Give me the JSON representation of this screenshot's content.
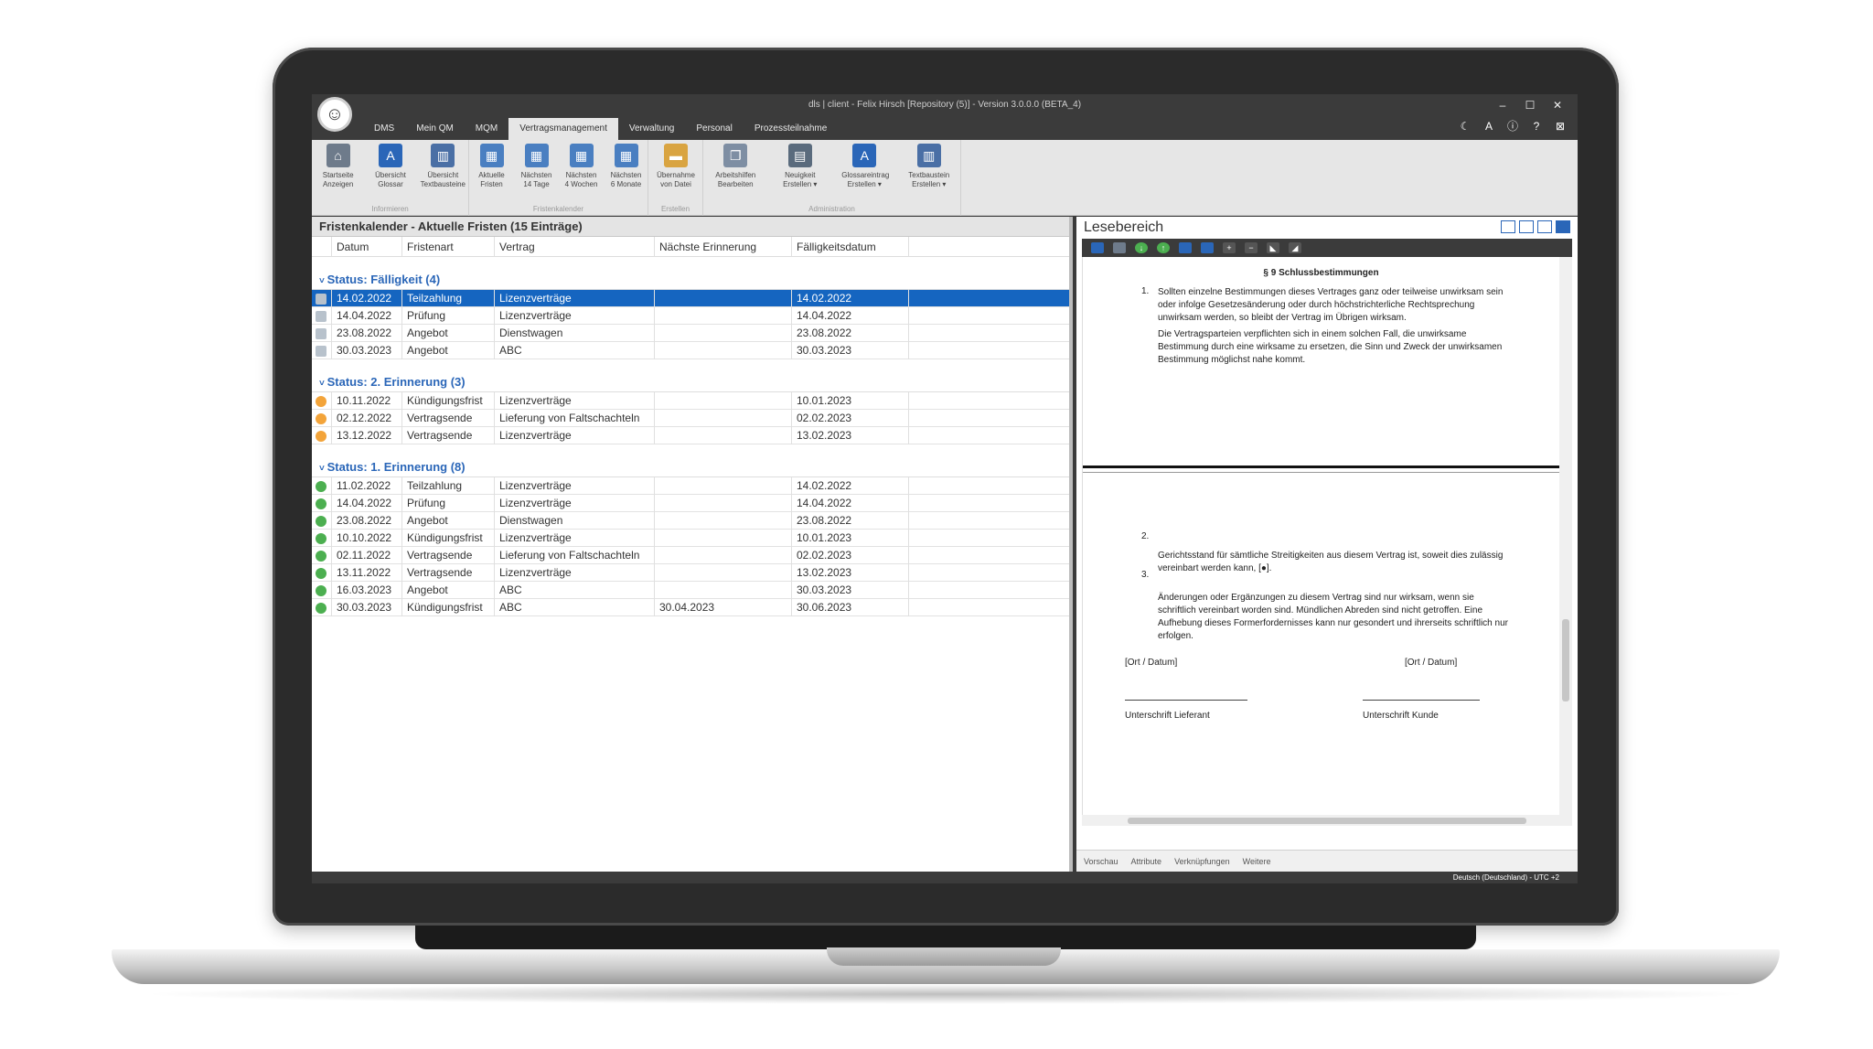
{
  "window": {
    "title": "dls | client - Felix Hirsch [Repository (5)] - Version 3.0.0.0 (BETA_4)",
    "controls": [
      "–",
      "☐",
      "✕"
    ]
  },
  "menu": {
    "tabs": [
      "DMS",
      "Mein QM",
      "MQM",
      "Vertragsmanagement",
      "Verwaltung",
      "Personal",
      "Prozessteilnahme"
    ],
    "active": "Vertragsmanagement"
  },
  "title_icons": [
    "moon-icon",
    "font-icon",
    "info-icon",
    "help-icon",
    "close-box-icon"
  ],
  "ribbon": {
    "groups": [
      {
        "label": "Informieren",
        "buttons": [
          {
            "label": "Startseite\nAnzeigen",
            "icon": "home-icon"
          },
          {
            "label": "Übersicht\nGlossar",
            "icon": "glossary-icon"
          },
          {
            "label": "Übersicht\nTextbausteine",
            "icon": "textblocks-icon"
          }
        ]
      },
      {
        "label": "Fristenkalender",
        "buttons": [
          {
            "label": "Aktuelle\nFristen",
            "icon": "calendar-icon"
          },
          {
            "label": "Nächsten\n14 Tage",
            "icon": "calendar-icon"
          },
          {
            "label": "Nächsten\n4 Wochen",
            "icon": "calendar-icon"
          },
          {
            "label": "Nächsten\n6 Monate",
            "icon": "calendar-icon"
          }
        ]
      },
      {
        "label": "Erstellen",
        "buttons": [
          {
            "label": "Übernahme\nvon Datei",
            "icon": "folder-icon"
          }
        ]
      },
      {
        "label": "Administration",
        "buttons": [
          {
            "label": "Arbeitshilfen\nBearbeiten",
            "icon": "documents-icon"
          },
          {
            "label": "Neuigkeit\nErstellen ▾",
            "icon": "news-icon"
          },
          {
            "label": "Glossareintrag\nErstellen ▾",
            "icon": "glossary-add-icon"
          },
          {
            "label": "Textbaustein\nErstellen ▾",
            "icon": "textblock-add-icon"
          }
        ]
      }
    ]
  },
  "left": {
    "title": "Fristenkalender - Aktuelle Fristen (15 Einträge)",
    "columns": [
      "Datum",
      "Fristenart",
      "Vertrag",
      "Nächste Erinnerung",
      "Fälligkeitsdatum"
    ],
    "groups": [
      {
        "title": "Status: Fälligkeit (4)",
        "status": "doc",
        "rows": [
          [
            "14.02.2022",
            "Teilzahlung",
            "Lizenzverträge",
            "",
            "14.02.2022"
          ],
          [
            "14.04.2022",
            "Prüfung",
            "Lizenzverträge",
            "",
            "14.04.2022"
          ],
          [
            "23.08.2022",
            "Angebot",
            "Dienstwagen",
            "",
            "23.08.2022"
          ],
          [
            "30.03.2023",
            "Angebot",
            "ABC",
            "",
            "30.03.2023"
          ]
        ]
      },
      {
        "title": "Status: 2. Erinnerung (3)",
        "status": "orange",
        "rows": [
          [
            "10.11.2022",
            "Kündigungsfrist",
            "Lizenzverträge",
            "",
            "10.01.2023"
          ],
          [
            "02.12.2022",
            "Vertragsende",
            "Lieferung von Faltschachteln",
            "",
            "02.02.2023"
          ],
          [
            "13.12.2022",
            "Vertragsende",
            "Lizenzverträge",
            "",
            "13.02.2023"
          ]
        ]
      },
      {
        "title": "Status: 1. Erinnerung (8)",
        "status": "green",
        "rows": [
          [
            "11.02.2022",
            "Teilzahlung",
            "Lizenzverträge",
            "",
            "14.02.2022"
          ],
          [
            "14.04.2022",
            "Prüfung",
            "Lizenzverträge",
            "",
            "14.04.2022"
          ],
          [
            "23.08.2022",
            "Angebot",
            "Dienstwagen",
            "",
            "23.08.2022"
          ],
          [
            "10.10.2022",
            "Kündigungsfrist",
            "Lizenzverträge",
            "",
            "10.01.2023"
          ],
          [
            "02.11.2022",
            "Vertragsende",
            "Lieferung von Faltschachteln",
            "",
            "02.02.2023"
          ],
          [
            "13.11.2022",
            "Vertragsende",
            "Lizenzverträge",
            "",
            "13.02.2023"
          ],
          [
            "16.03.2023",
            "Angebot",
            "ABC",
            "",
            "30.03.2023"
          ],
          [
            "30.03.2023",
            "Kündigungsfrist",
            "ABC",
            "30.04.2023",
            "30.06.2023"
          ]
        ]
      }
    ]
  },
  "right": {
    "title": "Lesebereich",
    "doc": {
      "heading": "§ 9 Schlussbestimmungen",
      "p1_num": "1.",
      "p1": "Sollten einzelne Bestimmungen dieses Vertrages ganz oder teilweise unwirksam sein oder infolge Gesetzesänderung oder durch höchstrichterliche Rechtsprechung unwirksam werden, so bleibt der Vertrag im Übrigen wirksam.",
      "p1b": "Die Vertragsparteien verpflichten sich in einem solchen Fall, die unwirksame Bestimmung durch eine wirksame zu ersetzen, die Sinn und Zweck der unwirksamen Bestimmung möglichst nahe kommt.",
      "p2_num": "2.",
      "p2": "Gerichtsstand für sämtliche Streitigkeiten aus diesem Vertrag ist, soweit dies zulässig vereinbart werden kann, [●].",
      "p3_num": "3.",
      "p3": "Änderungen oder Ergänzungen zu diesem Vertrag sind nur wirksam, wenn sie schriftlich vereinbart worden sind. Mündlichen Abreden sind nicht getroffen. Eine Aufhebung dieses Formerfordernisses kann nur gesondert und ihrerseits schriftlich nur erfolgen.",
      "place_left": "[Ort / Datum]",
      "place_right": "[Ort / Datum]",
      "sig_left": "Unterschrift Lieferant",
      "sig_right": "Unterschrift Kunde"
    },
    "tabs": [
      "Vorschau",
      "Attribute",
      "Verknüpfungen",
      "Weitere"
    ]
  },
  "statusbar": "Deutsch (Deutschland) - UTC +2",
  "colors": {
    "accent": "#1565c0",
    "group_title": "#2a66b8",
    "chrome": "#3b3b3b",
    "ribbon": "#e6e6e6"
  }
}
